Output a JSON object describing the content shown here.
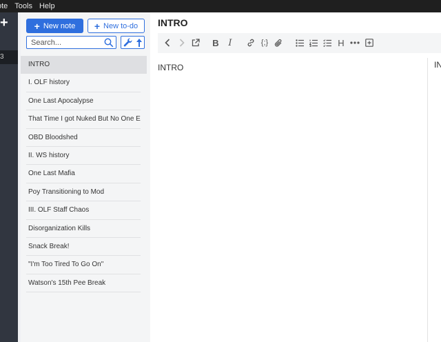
{
  "menubar": {
    "items": [
      "ote",
      "Tools",
      "Help"
    ]
  },
  "sidebar": {
    "add_symbol": "+",
    "selected_fragment": "3"
  },
  "notelist": {
    "new_note_label": "New note",
    "new_todo_label": "New to-do",
    "search_placeholder": "Search...",
    "notes": [
      "INTRO",
      "I. OLF history",
      "One Last Apocalypse",
      "That Time I got Nuked But No One Else Did",
      "OBD Bloodshed",
      "II. WS history",
      "One Last Mafia",
      "Poy Transitioning to Mod",
      "III. OLF Staff Chaos",
      "Disorganization Kills",
      "Snack Break!",
      "\"I'm Too Tired To Go On\"",
      "Watson's 15th Pee Break"
    ],
    "selected_index": 0
  },
  "editor": {
    "title": "INTRO",
    "body": "INTRO",
    "preview_fragment": "IN",
    "toolbar_heading_label": "H",
    "toolbar_code_label": "{;}"
  },
  "colors": {
    "accent": "#2f6fde",
    "sidebar": "#313640",
    "menubar": "#1f1f1f"
  }
}
